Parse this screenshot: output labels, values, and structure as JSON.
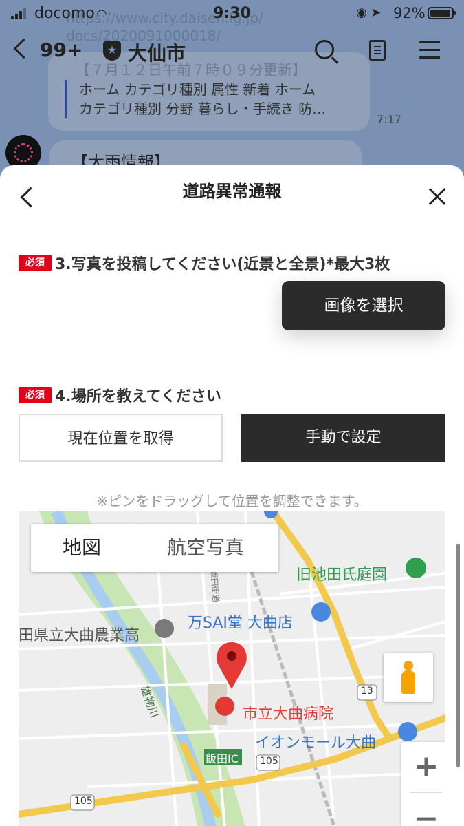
{
  "status_bar": {
    "carrier": "docomo",
    "time": "9:30",
    "battery": "92%"
  },
  "chat": {
    "unread_count": "99+",
    "title": "大仙市",
    "faded_url_1": "https://www.city.daisen.lg.jp/",
    "faded_url_2": "docs/2020091000018/",
    "faded_update": "【７月１２日午前７時０９分更新】",
    "preview_line_1": "ホーム カテゴリ種別 属性 新着 ホーム",
    "preview_line_2": "カテゴリ種別 分野 暮らし・手続き 防…",
    "message_time": "7:17",
    "second_message": "【大雨情報】"
  },
  "sheet": {
    "title": "道路異常通報",
    "required_label": "必須",
    "q3_label": "3.写真を投稿してください(近景と全景)*最大3枚",
    "select_image_button": "画像を選択",
    "q4_label": "4.場所を教えてください",
    "get_current_location_button": "現在位置を取得",
    "manual_set_button": "手動で設定",
    "hint": "※ピンをドラッグして位置を調整できます。"
  },
  "map": {
    "type_map": "地図",
    "type_aerial": "航空写真",
    "labels": {
      "garden": "旧池田氏庭園",
      "store": "万SAI堂 大曲店",
      "school": "田県立大曲農業高",
      "hospital": "市立大曲病院",
      "mall": "イオンモール大曲",
      "ic": "飯田IC",
      "river": "雄物川",
      "route_105a": "105",
      "route_105b": "105",
      "route_13": "13",
      "local_road": "飯田街道"
    },
    "zoom_in": "+",
    "zoom_out": "−",
    "colors": {
      "pin": "#e53935",
      "river": "#a8cdf0",
      "green": "#b9e0a5",
      "highway": "#f7d96e",
      "poi_blue": "#4a88e0",
      "poi_green": "#2e9e4f"
    }
  }
}
